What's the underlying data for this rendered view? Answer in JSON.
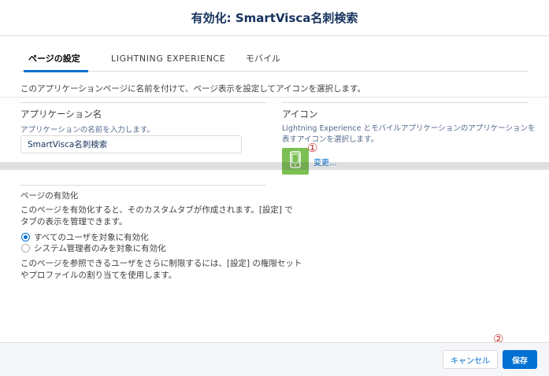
{
  "modal": {
    "title": "有効化: SmartVisca名刺検索"
  },
  "tabs": [
    {
      "label": "ページの設定",
      "active": true
    },
    {
      "label": "LIGHTNING EXPERIENCE",
      "active": false
    },
    {
      "label": "モバイル",
      "active": false
    }
  ],
  "description": "このアプリケーションページに名前を付けて、ページ表示を設定してアイコンを選択します。",
  "app_name_section": {
    "title": "アプリケーション名",
    "help": "アプリケーションの名前を入力します。",
    "value": "SmartVisca名刺検索"
  },
  "icon_section": {
    "title": "アイコン",
    "help_line1": "Lightning Experience とモバイルアプリケーションのアプリケーションを",
    "help_line2": "表すアイコンを選択します。",
    "icon_name": "mobile-phone-icon",
    "icon_color": "#7cc054",
    "change_label": "変更..."
  },
  "activation_section": {
    "title": "ページの有効化",
    "para1_line1": "このページを有効化すると、そのカスタムタブが作成されます。[設定] で",
    "para1_line2": "タブの表示を管理できます。",
    "options": [
      {
        "label": "すべてのユーザを対象に有効化",
        "checked": true
      },
      {
        "label": "システム管理者のみを対象に有効化",
        "checked": false
      }
    ],
    "para2_line1": "このページを参照できるユーザをさらに制限するには、[設定] の権限セット",
    "para2_line2": "やプロファイルの割り当てを使用します。"
  },
  "markers": {
    "one": "①",
    "two": "②"
  },
  "footer": {
    "cancel_label": "キャンセル",
    "save_label": "保存"
  },
  "colors": {
    "brand": "#0070d2",
    "marker": "#c23934"
  }
}
